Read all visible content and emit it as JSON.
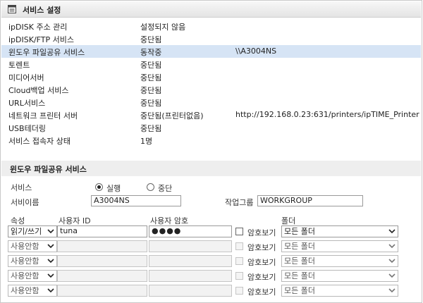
{
  "header": {
    "title": "서비스 설정",
    "icon": "window-list-icon"
  },
  "status_rows": [
    {
      "name": "ipDISK 주소 관리",
      "status": "설정되지 않음",
      "extra": ""
    },
    {
      "name": "ipDISK/FTP 서비스",
      "status": "중단됨",
      "extra": ""
    },
    {
      "name": "윈도우 파일공유 서비스",
      "status": "동작중",
      "extra": "\\\\A3004NS",
      "highlight": true
    },
    {
      "name": "토렌트",
      "status": "중단됨",
      "extra": ""
    },
    {
      "name": "미디어서버",
      "status": "중단됨",
      "extra": ""
    },
    {
      "name": "Cloud백업 서비스",
      "status": "중단됨",
      "extra": ""
    },
    {
      "name": "URL서비스",
      "status": "중단됨",
      "extra": ""
    },
    {
      "name": "네트워크 프린터 서버",
      "status": "중단됨(프린터없음)",
      "extra": "http://192.168.0.23:631/printers/ipTIME_Printer"
    },
    {
      "name": "USB테더링",
      "status": "중단됨",
      "extra": ""
    },
    {
      "name": "서비스 접속자 상태",
      "status": "1명",
      "extra": ""
    }
  ],
  "share": {
    "title": "윈도우 파일공유 서비스",
    "service_label": "서비스",
    "radio_run": "실행",
    "radio_stop": "중단",
    "service_state": "실행",
    "name_label": "서비이름",
    "name_value": "A3004NS",
    "workgroup_label": "작업그룹",
    "workgroup_value": "WORKGROUP",
    "columns": {
      "attr": "속성",
      "user_id": "사용자 ID",
      "password": "사용자 암호",
      "folder": "폴더"
    },
    "show_pw_label": "암호보기",
    "accounts": [
      {
        "attr": "읽기/쓰기",
        "user_id": "tuna",
        "password": "●●●●",
        "folder": "모든 폴더",
        "enabled": true
      },
      {
        "attr": "사용안함",
        "user_id": "",
        "password": "",
        "folder": "모든 폴더",
        "enabled": false
      },
      {
        "attr": "사용안함",
        "user_id": "",
        "password": "",
        "folder": "모든 폴더",
        "enabled": false
      },
      {
        "attr": "사용안함",
        "user_id": "",
        "password": "",
        "folder": "모든 폴더",
        "enabled": false
      },
      {
        "attr": "사용안함",
        "user_id": "",
        "password": "",
        "folder": "모든 폴더",
        "enabled": false
      }
    ]
  }
}
